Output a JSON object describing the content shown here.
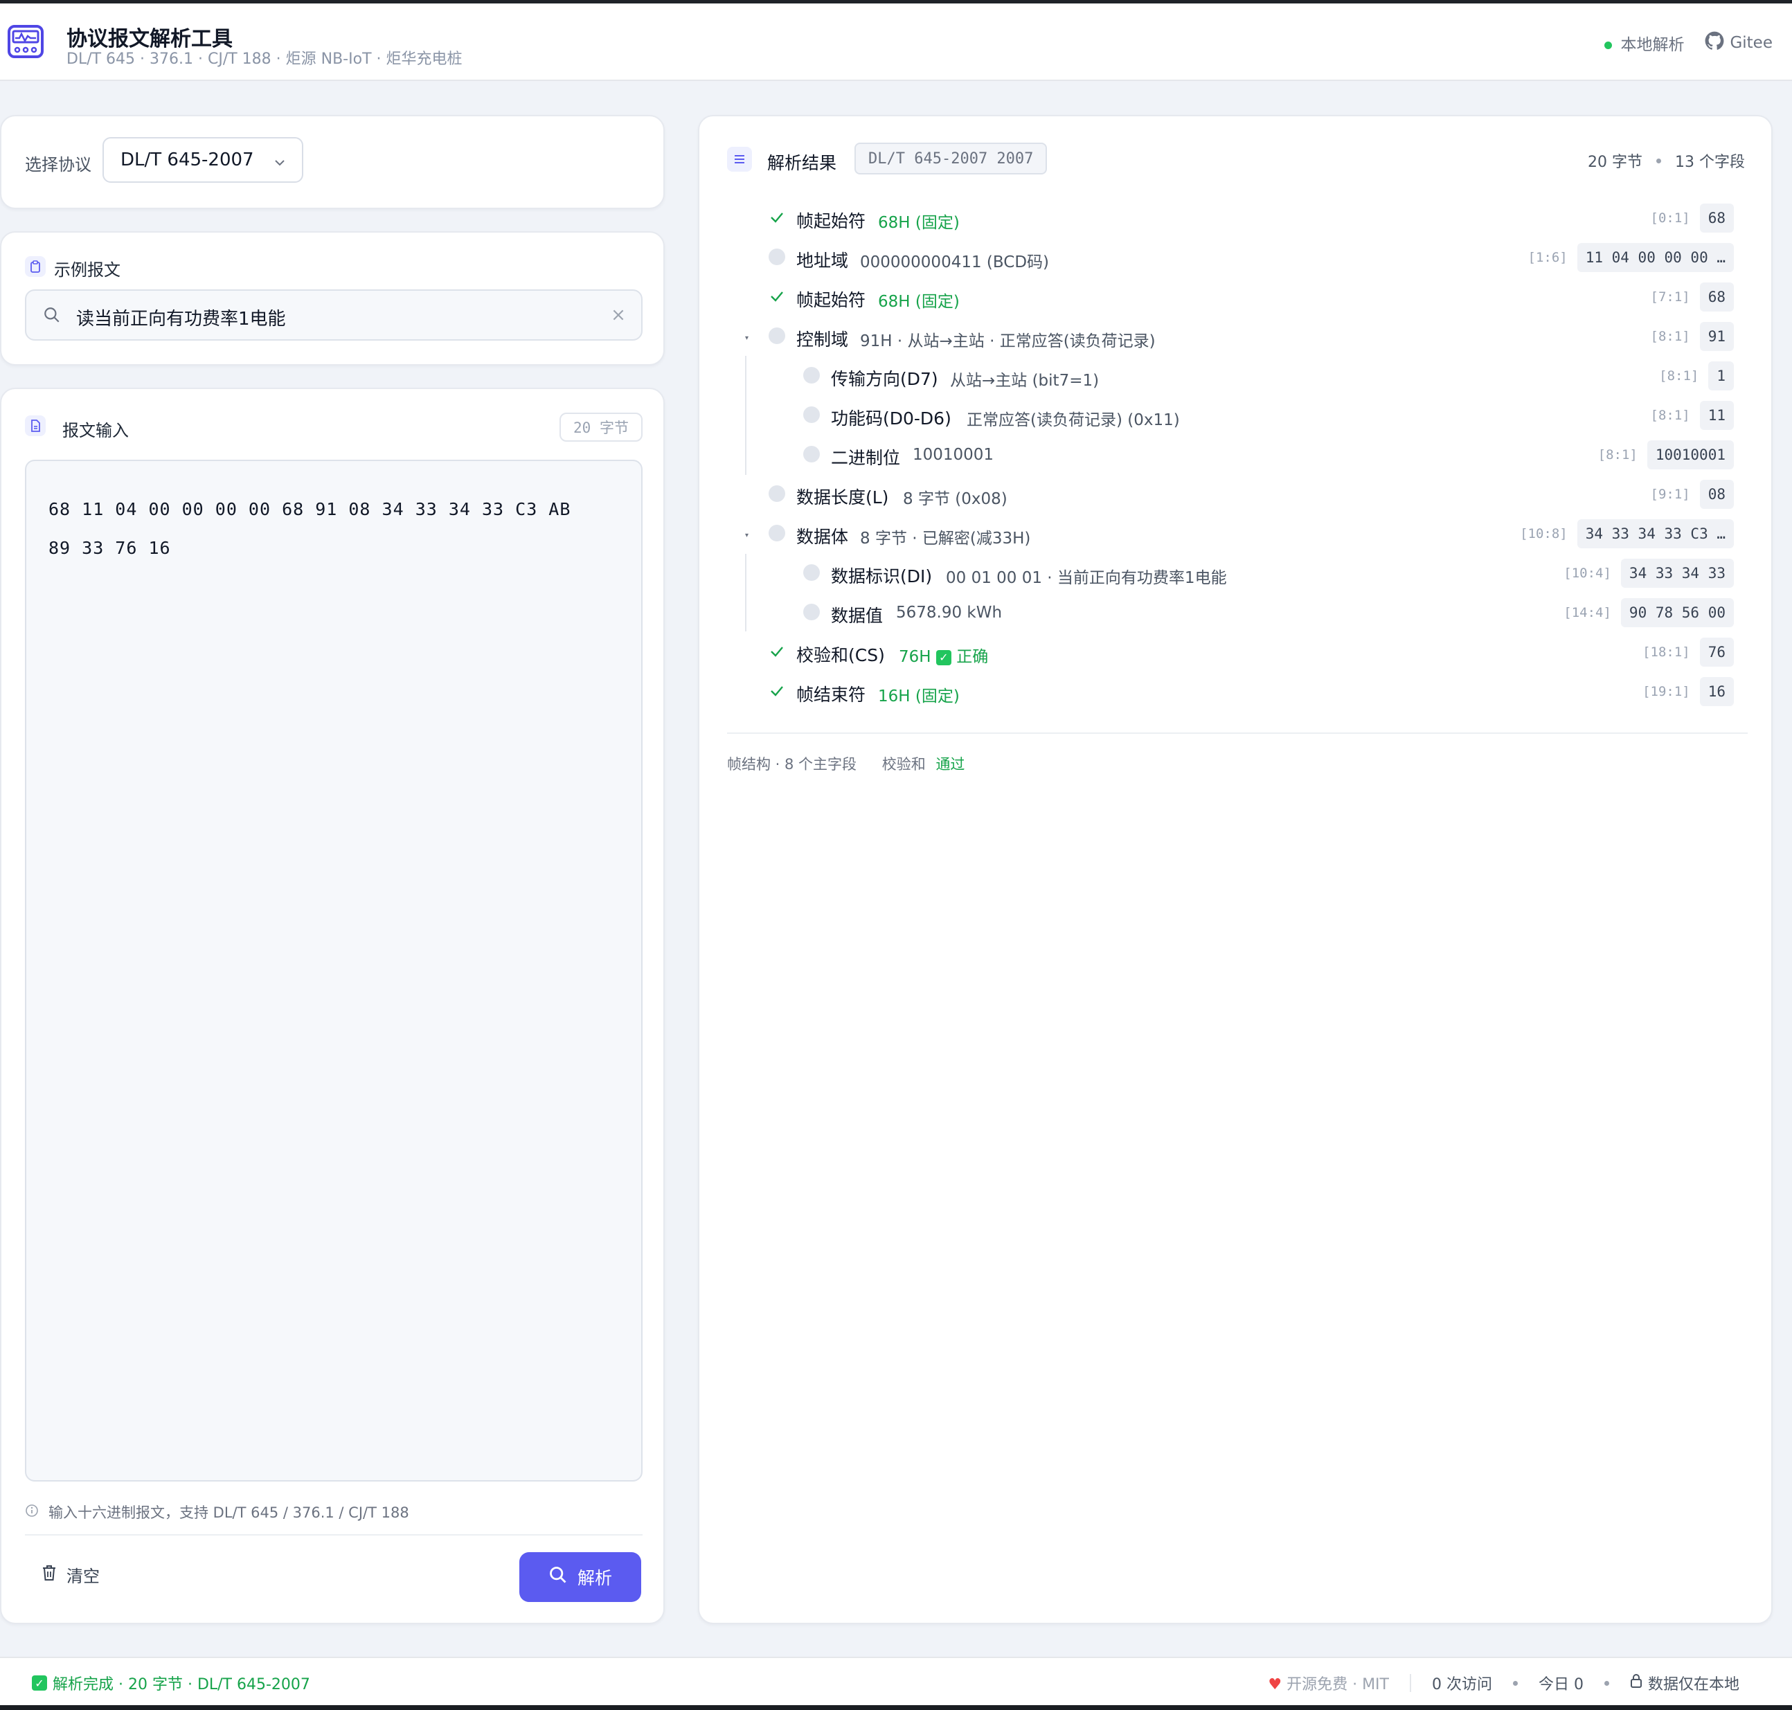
{
  "header": {
    "title": "协议报文解析工具",
    "subtitle": "DL/T 645 · 376.1 · CJ/T 188 · 炬源 NB-IoT · 炬华充电桩",
    "local_parse": "本地解析",
    "gitee": "Gitee"
  },
  "protocol": {
    "label": "选择协议",
    "selected": "DL/T 645-2007"
  },
  "example": {
    "title": "示例报文",
    "value": "读当前正向有功费率1电能"
  },
  "input": {
    "title": "报文输入",
    "byte_count": "20 字节",
    "line1": "68 11 04 00 00 00 00 68 91 08 34 33 34 33 C3 AB",
    "line2": "89 33 76 16",
    "hint": "输入十六进制报文，支持 DL/T 645 / 376.1 / CJ/T 188",
    "clear_label": "清空",
    "parse_label": "解析"
  },
  "result": {
    "title": "解析结果",
    "protocol_badge": "DL/T 645-2007 2007",
    "bytes": "20 字节",
    "fields": "13 个字段",
    "rows": [
      {
        "name": "帧起始符",
        "value": "68H (固定)",
        "offset": "[0:1]",
        "hex": "68"
      },
      {
        "name": "地址域",
        "value": "000000000411 (BCD码)",
        "offset": "[1:6]",
        "hex": "11 04 00 00 00 …"
      },
      {
        "name": "帧起始符",
        "value": "68H (固定)",
        "offset": "[7:1]",
        "hex": "68"
      },
      {
        "name": "控制域",
        "value": "91H · 从站→主站 · 正常应答(读负荷记录)",
        "offset": "[8:1]",
        "hex": "91"
      },
      {
        "name": "传输方向(D7)",
        "value": "从站→主站 (bit7=1)",
        "offset": "[8:1]",
        "hex": "1"
      },
      {
        "name": "功能码(D0-D6)",
        "value": "正常应答(读负荷记录) (0x11)",
        "offset": "[8:1]",
        "hex": "11"
      },
      {
        "name": "二进制位",
        "value": "10010001",
        "offset": "[8:1]",
        "hex": "10010001"
      },
      {
        "name": "数据长度(L)",
        "value": "8 字节 (0x08)",
        "offset": "[9:1]",
        "hex": "08"
      },
      {
        "name": "数据体",
        "value": "8 字节 · 已解密(减33H)",
        "offset": "[10:8]",
        "hex": "34 33 34 33 C3 …"
      },
      {
        "name": "数据标识(DI)",
        "value": "00 01 00 01 · 当前正向有功费率1电能",
        "offset": "[10:4]",
        "hex": "34 33 34 33"
      },
      {
        "name": "数据值",
        "value": "5678.90 kWh",
        "offset": "[14:4]",
        "hex": "90 78 56 00"
      },
      {
        "name": "校验和(CS)",
        "value": "76H",
        "value_ok": "正确",
        "offset": "[18:1]",
        "hex": "76"
      },
      {
        "name": "帧结束符",
        "value": "16H (固定)",
        "offset": "[19:1]",
        "hex": "16"
      }
    ],
    "summary_frame": "帧结构 · 8 个主字段",
    "summary_cs_label": "校验和",
    "summary_cs_value": "通过"
  },
  "statusbar": {
    "left": "解析完成 · 20 字节 · DL/T 645-2007",
    "license": "开源免费 · MIT",
    "visits": "0 次访问",
    "today": "今日 0",
    "privacy": "数据仅在本地"
  },
  "colors": {
    "accent": "#5b5bf0",
    "ok": "#16a34a"
  }
}
